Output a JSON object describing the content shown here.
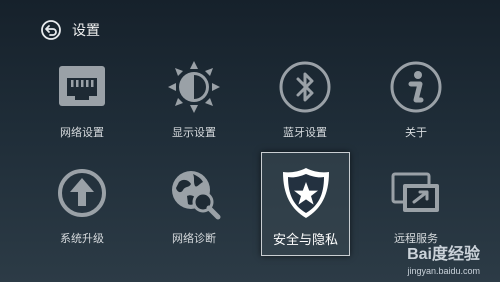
{
  "header": {
    "title": "设置",
    "back_icon": "back-arrow-icon"
  },
  "tiles": [
    {
      "label": "网络设置",
      "icon": "ethernet-port-icon"
    },
    {
      "label": "显示设置",
      "icon": "brightness-icon"
    },
    {
      "label": "蓝牙设置",
      "icon": "bluetooth-icon"
    },
    {
      "label": "关于",
      "icon": "info-icon"
    },
    {
      "label": "系统升级",
      "icon": "upgrade-arrow-icon"
    },
    {
      "label": "网络诊断",
      "icon": "globe-magnifier-icon"
    },
    {
      "label": "安全与隐私",
      "icon": "shield-star-icon",
      "selected": true
    },
    {
      "label": "远程服务",
      "icon": "remote-screen-icon"
    }
  ],
  "watermark": {
    "logo": "Bai度经验",
    "url": "jingyan.baidu.com"
  },
  "colors": {
    "icon": "#9aa1a7",
    "accent_blue": "#5a86c7",
    "selected_border": "#c9ced2"
  }
}
